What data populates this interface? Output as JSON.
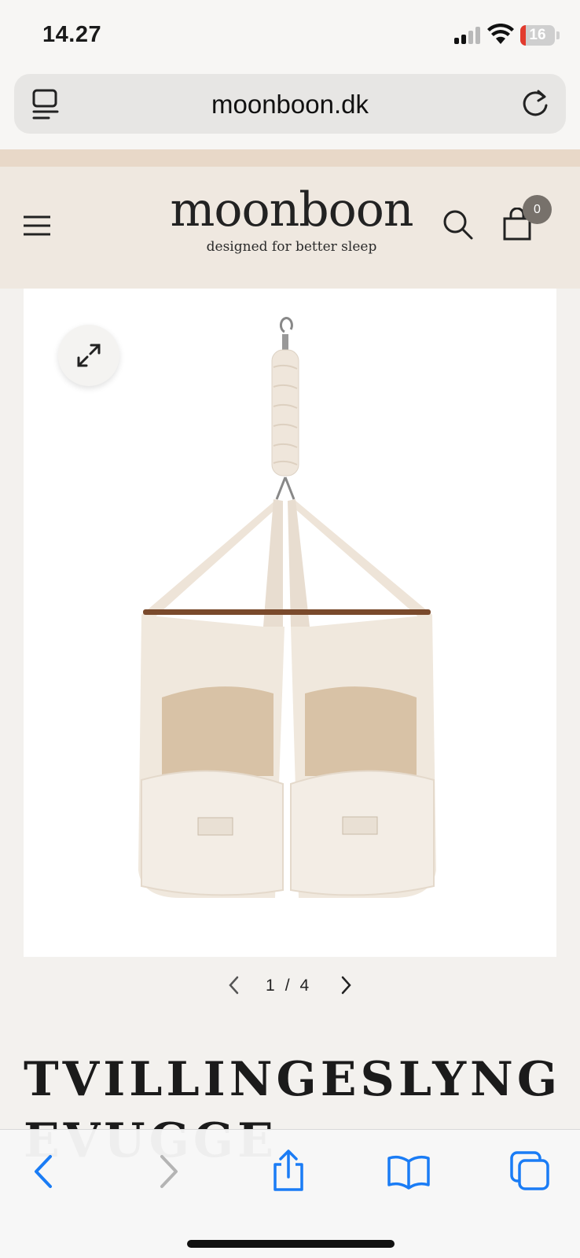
{
  "status_bar": {
    "time": "14.27",
    "battery_level": "16"
  },
  "browser": {
    "url": "moonboon.dk"
  },
  "header": {
    "logo_text": "moonboon",
    "tagline": "designed for better sleep",
    "cart_count": "0"
  },
  "gallery": {
    "current": "1",
    "separator": "/",
    "total": "4"
  },
  "product": {
    "title": "TVILLINGESLYNGEVUGGE"
  },
  "colors": {
    "header_bg": "#efe8e0",
    "promo_strip": "#e8d8c8",
    "accent_blue": "#1a7cf5",
    "badge_bg": "#77716b"
  },
  "icons": {
    "reader": "reader-icon",
    "reload": "reload-icon",
    "menu": "hamburger-menu-icon",
    "search": "search-icon",
    "cart": "shopping-bag-icon",
    "expand": "expand-icon",
    "back": "back-icon",
    "forward": "forward-icon",
    "share": "share-icon",
    "bookmarks": "bookmarks-icon",
    "tabs": "tabs-icon"
  }
}
